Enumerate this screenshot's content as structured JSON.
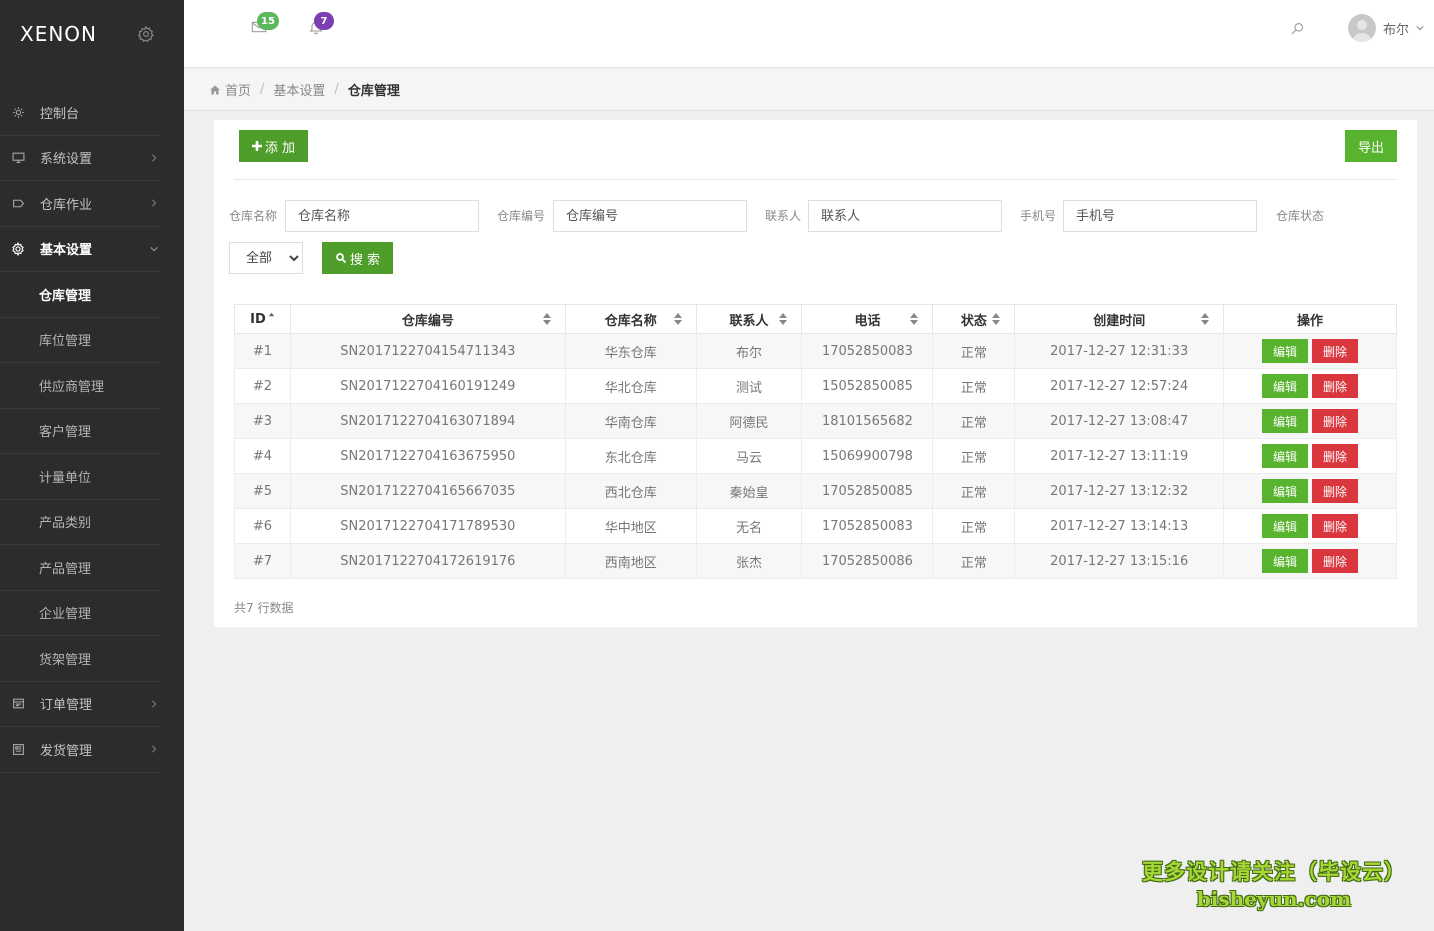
{
  "brand": {
    "logo": "XENON"
  },
  "colors": {
    "sidebar_bg": "#2b2c2e",
    "primary_green": "#4f9d2a",
    "light_green": "#58b32e",
    "danger_red": "#d9363e",
    "mail_badge": "#5cb85c",
    "bell_badge": "#7b3fb2"
  },
  "sidebar": {
    "items": [
      {
        "label": "控制台",
        "icon": "dashboard-icon"
      },
      {
        "label": "系统设置",
        "icon": "monitor-icon"
      },
      {
        "label": "仓库作业",
        "icon": "tag-icon"
      },
      {
        "label": "基本设置",
        "icon": "gear-icon"
      },
      {
        "label": "订单管理",
        "icon": "order-icon"
      },
      {
        "label": "发货管理",
        "icon": "shipping-icon"
      }
    ],
    "sub_items": [
      {
        "label": "仓库管理"
      },
      {
        "label": "库位管理"
      },
      {
        "label": "供应商管理"
      },
      {
        "label": "客户管理"
      },
      {
        "label": "计量单位"
      },
      {
        "label": "产品类别"
      },
      {
        "label": "产品管理"
      },
      {
        "label": "企业管理"
      },
      {
        "label": "货架管理"
      }
    ]
  },
  "header": {
    "mail_count": "15",
    "notification_count": "7",
    "user_name": "布尔"
  },
  "breadcrumb": {
    "home": "首页",
    "parent": "基本设置",
    "current": "仓库管理"
  },
  "toolbar": {
    "add_label": "添 加",
    "export_label": "导出"
  },
  "filters": {
    "name_label": "仓库名称",
    "name_placeholder": "仓库名称",
    "code_label": "仓库编号",
    "code_placeholder": "仓库编号",
    "contact_label": "联系人",
    "contact_placeholder": "联系人",
    "phone_label": "手机号",
    "phone_placeholder": "手机号",
    "status_label": "仓库状态",
    "status_selected": "全部",
    "search_label": "搜 索"
  },
  "table": {
    "columns": [
      "ID",
      "仓库编号",
      "仓库名称",
      "联系人",
      "电话",
      "状态",
      "创建时间",
      "操作"
    ],
    "rows": [
      [
        "#1",
        "SN2017122704154711343",
        "华东仓库",
        "布尔",
        "17052850083",
        "正常",
        "2017-12-27 12:31:33"
      ],
      [
        "#2",
        "SN2017122704160191249",
        "华北仓库",
        "测试",
        "15052850085",
        "正常",
        "2017-12-27 12:57:24"
      ],
      [
        "#3",
        "SN2017122704163071894",
        "华南仓库",
        "阿德民",
        "18101565682",
        "正常",
        "2017-12-27 13:08:47"
      ],
      [
        "#4",
        "SN2017122704163675950",
        "东北仓库",
        "马云",
        "15069900798",
        "正常",
        "2017-12-27 13:11:19"
      ],
      [
        "#5",
        "SN2017122704165667035",
        "西北仓库",
        "秦始皇",
        "17052850085",
        "正常",
        "2017-12-27 13:12:32"
      ],
      [
        "#6",
        "SN2017122704171789530",
        "华中地区",
        "无名",
        "17052850083",
        "正常",
        "2017-12-27 13:14:13"
      ],
      [
        "#7",
        "SN2017122704172619176",
        "西南地区",
        "张杰",
        "17052850086",
        "正常",
        "2017-12-27 13:15:16"
      ]
    ],
    "edit_label": "编辑",
    "delete_label": "删除",
    "total_text": "共7 行数据"
  },
  "watermark": {
    "line1": "更多设计请关注（毕设云）",
    "line2": "bisheyun.com"
  }
}
